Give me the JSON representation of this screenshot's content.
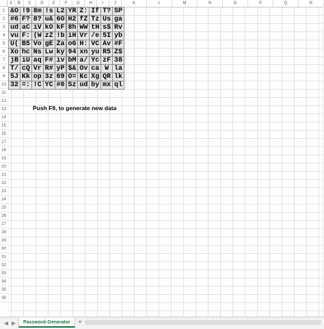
{
  "columns": [
    "A",
    "B",
    "C",
    "D",
    "E",
    "F",
    "G",
    "H",
    "I",
    "J",
    "K",
    "L",
    "M",
    "N",
    "O",
    "P",
    "Q",
    "R"
  ],
  "rows": [
    "1",
    "2",
    "3",
    "4",
    "5",
    "6",
    "7",
    "8",
    "9",
    "10",
    "11",
    "12",
    "13",
    "14",
    "15",
    "16",
    "17",
    "18",
    "19",
    "20",
    "21",
    "22",
    "23",
    "24",
    "25",
    "26",
    "27",
    "28",
    "29",
    "30",
    "31",
    "32",
    "33",
    "34",
    "35",
    "36"
  ],
  "passwords": [
    [
      "&O",
      "!9",
      "8m",
      "!s",
      "L2",
      "YR",
      "Z:",
      "If",
      "T?",
      "SP"
    ],
    [
      "#6",
      "F?",
      "8?",
      "u&",
      "6O",
      "H2",
      "fZ",
      "Tz",
      "Us",
      "ga"
    ],
    [
      "ud",
      "aC",
      "iV",
      "kO",
      "kF",
      "8h",
      "WW",
      "tH",
      "s$",
      "Rv"
    ],
    [
      "vu",
      "F:",
      "(W",
      "zZ",
      "!b",
      "iH",
      "Vr",
      "/e",
      "5I",
      "yb"
    ],
    [
      "U(",
      "B5",
      "Vo",
      "gE",
      "Za",
      "oG",
      "H:",
      "VC",
      "Av",
      "#F"
    ],
    [
      "Xo",
      "hc",
      "Ns",
      "Lw",
      "ky",
      "94",
      "xn",
      "yu",
      "R5",
      "Z$"
    ],
    [
      "jB",
      "iU",
      "aq",
      "F#",
      "iv",
      "bM",
      "a/",
      "Yc",
      "zF",
      "38"
    ],
    [
      "T/",
      "cQ",
      "Vr",
      "R#",
      "yP",
      "$&",
      "Ov",
      "ca",
      "W",
      "la"
    ],
    [
      "5J",
      "Kk",
      "op",
      "3z",
      "69",
      "O=",
      "Kc",
      "Xg",
      "QR",
      "lk"
    ],
    [
      "32",
      "=:",
      "!C",
      "YC",
      "#0",
      "Sz",
      "ud",
      "by",
      "mx",
      "ql"
    ]
  ],
  "note": "Push F9, to generate new data",
  "sheet_tab": "Password-Generator",
  "add_tab": "+",
  "nav_prev": "◀",
  "nav_next": "▶"
}
